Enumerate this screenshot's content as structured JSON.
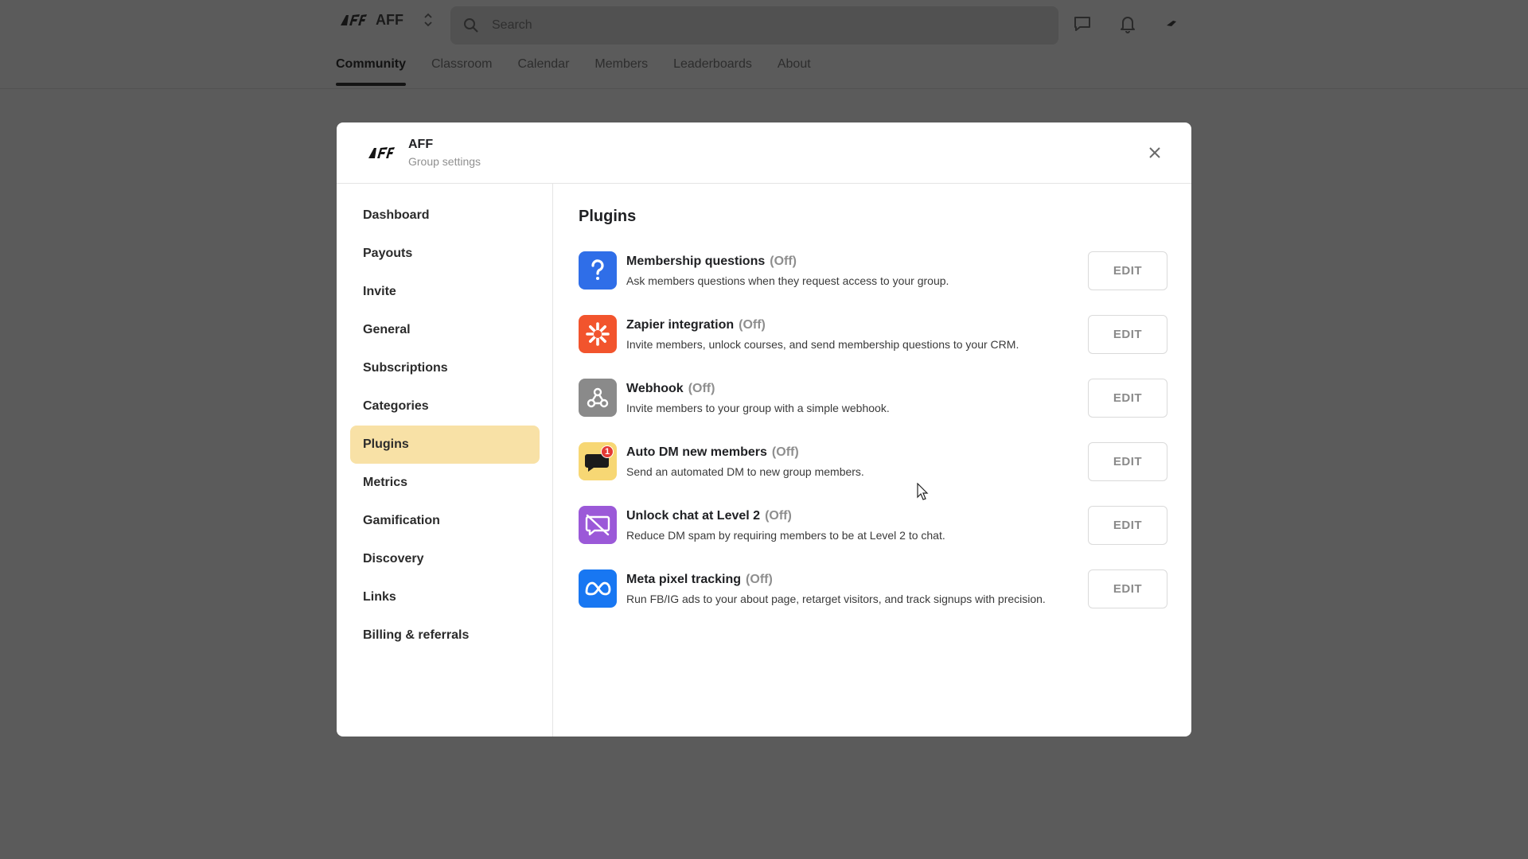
{
  "header": {
    "group_name": "AFF",
    "search_placeholder": "Search"
  },
  "nav_tabs": [
    {
      "label": "Community",
      "active": true
    },
    {
      "label": "Classroom"
    },
    {
      "label": "Calendar"
    },
    {
      "label": "Members"
    },
    {
      "label": "Leaderboards"
    },
    {
      "label": "About"
    }
  ],
  "modal": {
    "group_name": "AFF",
    "subtitle": "Group settings",
    "sidebar": [
      {
        "label": "Dashboard"
      },
      {
        "label": "Payouts"
      },
      {
        "label": "Invite"
      },
      {
        "label": "General"
      },
      {
        "label": "Subscriptions"
      },
      {
        "label": "Categories"
      },
      {
        "label": "Plugins",
        "active": true
      },
      {
        "label": "Metrics"
      },
      {
        "label": "Gamification"
      },
      {
        "label": "Discovery"
      },
      {
        "label": "Links"
      },
      {
        "label": "Billing & referrals"
      }
    ],
    "section_title": "Plugins",
    "edit_label": "EDIT",
    "plugins": [
      {
        "name": "Membership questions",
        "status": "(Off)",
        "description": "Ask members questions when they request access to your group.",
        "icon": "question-icon",
        "color": "#2f6ee8"
      },
      {
        "name": "Zapier integration",
        "status": "(Off)",
        "description": "Invite members, unlock courses, and send membership questions to your CRM.",
        "icon": "zapier-icon",
        "color": "#f2542d"
      },
      {
        "name": "Webhook",
        "status": "(Off)",
        "description": "Invite members to your group with a simple webhook.",
        "icon": "webhook-icon",
        "color": "#8a8a8a"
      },
      {
        "name": "Auto DM new members",
        "status": "(Off)",
        "description": "Send an automated DM to new group members.",
        "icon": "chat-bubble-icon",
        "color": "#f7d774",
        "badge": "1"
      },
      {
        "name": "Unlock chat at Level 2",
        "status": "(Off)",
        "description": "Reduce DM spam by requiring members to be at Level 2 to chat.",
        "icon": "chat-off-icon",
        "color": "#9b59d8"
      },
      {
        "name": "Meta pixel tracking",
        "status": "(Off)",
        "description": "Run FB/IG ads to your about page, retarget visitors, and track signups with precision.",
        "icon": "meta-icon",
        "color": "#1877f2"
      }
    ]
  }
}
